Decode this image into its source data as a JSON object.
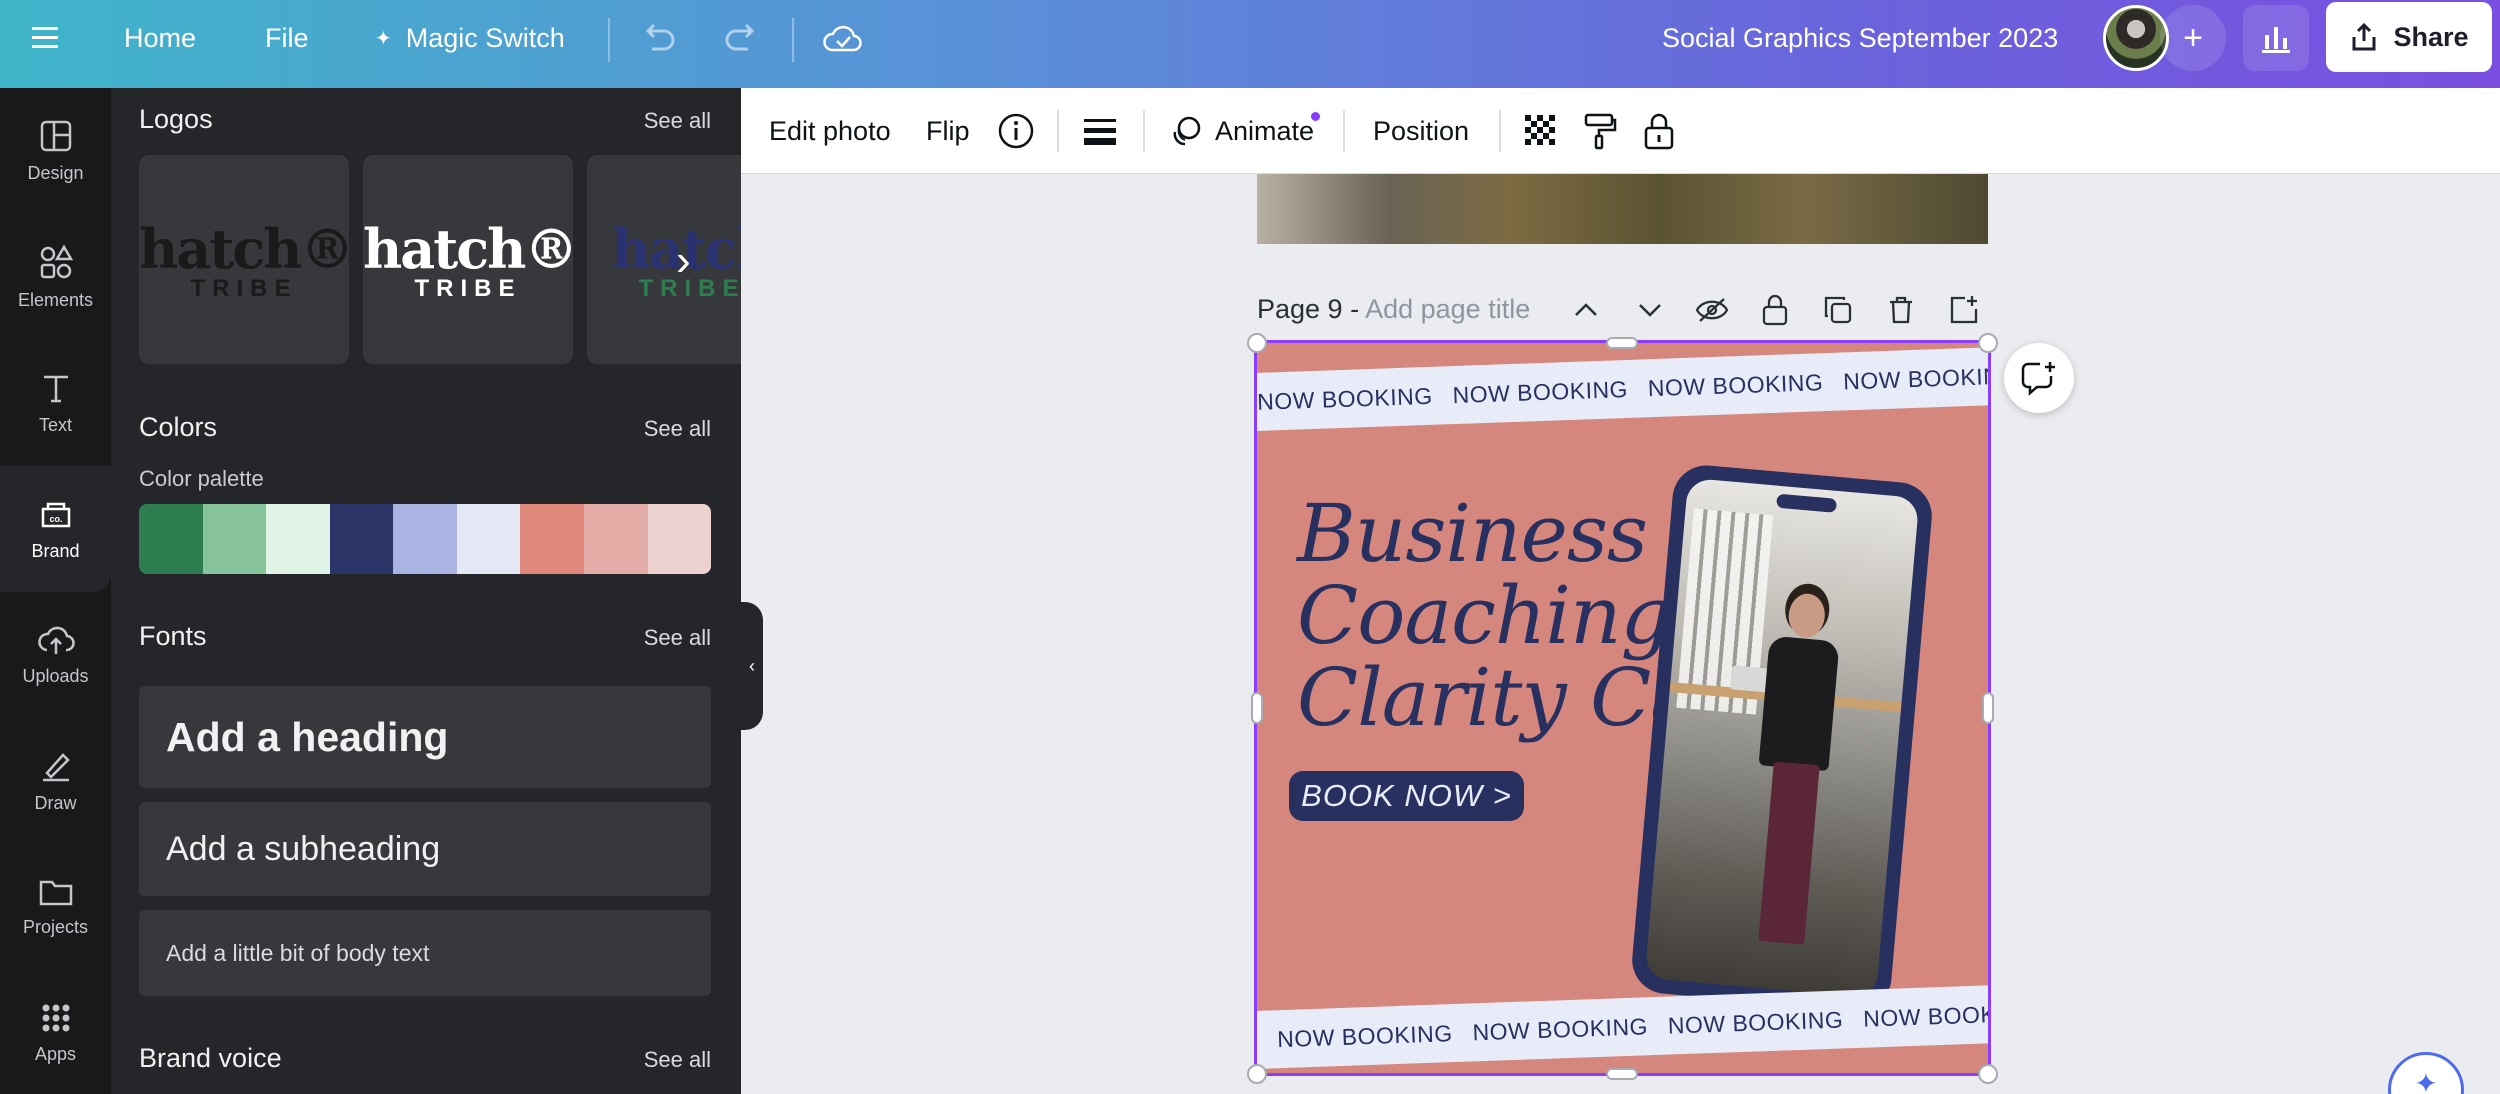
{
  "topbar": {
    "home": "Home",
    "file": "File",
    "magic_switch": "Magic Switch",
    "doc_title": "Social Graphics September 2023",
    "share": "Share"
  },
  "rail": {
    "items": [
      {
        "label": "Design",
        "icon": "layout-icon"
      },
      {
        "label": "Elements",
        "icon": "shapes-icon"
      },
      {
        "label": "Text",
        "icon": "text-icon"
      },
      {
        "label": "Brand",
        "icon": "brand-icon"
      },
      {
        "label": "Uploads",
        "icon": "cloud-upload-icon"
      },
      {
        "label": "Draw",
        "icon": "pen-icon"
      },
      {
        "label": "Projects",
        "icon": "folder-icon"
      },
      {
        "label": "Apps",
        "icon": "grid-icon"
      }
    ]
  },
  "panel": {
    "logos_title": "Logos",
    "colors_title": "Colors",
    "palette_label": "Color palette",
    "fonts_title": "Fonts",
    "brand_voice_title": "Brand voice",
    "see_all": "See all",
    "logos": [
      {
        "word": "hatch®",
        "sub": "TRIBE",
        "word_color": "#1a1a1a",
        "sub_color": "#1a1a1a"
      },
      {
        "word": "hatch®",
        "sub": "TRIBE",
        "word_color": "#ffffff",
        "sub_color": "#ffffff"
      },
      {
        "word": "hatch",
        "sub": "TRIBE",
        "word_color": "#2a3170",
        "sub_color": "#2e7d4f"
      }
    ],
    "palette": [
      "#2e7d4f",
      "#86c39b",
      "#dff3e6",
      "#2a3466",
      "#a9b4e3",
      "#e5e9f5",
      "#e0877c",
      "#e3aca6",
      "#ecd2cf"
    ],
    "fonts": {
      "heading": "Add a heading",
      "subheading": "Add a subheading",
      "body": "Add a little bit of body text"
    }
  },
  "toolbar": {
    "edit_photo": "Edit photo",
    "flip": "Flip",
    "animate": "Animate",
    "position": "Position"
  },
  "canvas": {
    "page_label": "Page 9 -",
    "page_title_placeholder": "Add page title",
    "band_text": "NOW BOOKING",
    "headline": [
      "Business",
      "Coaching",
      "Clarity Call"
    ],
    "cta": "BOOK NOW >",
    "bg_color": "#d6877d",
    "accent_color": "#27305f"
  }
}
